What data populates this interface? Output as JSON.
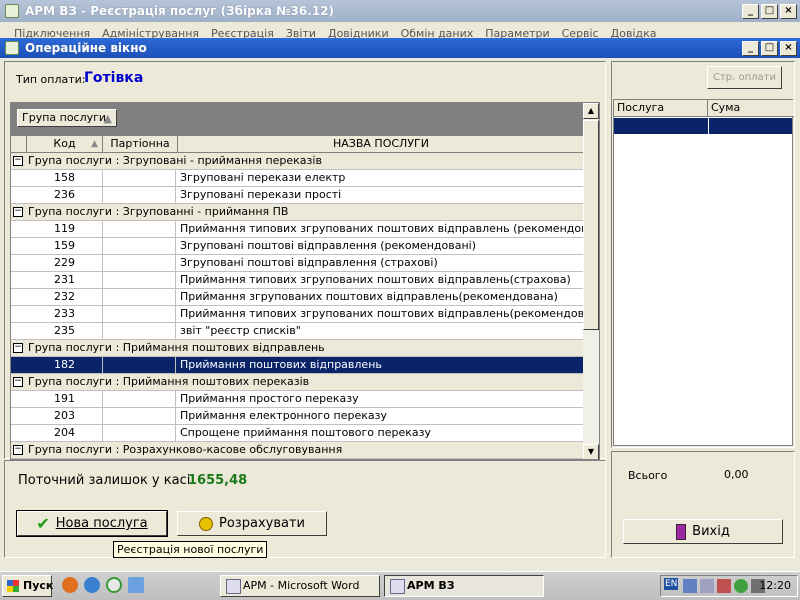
{
  "app": {
    "title": "АРМ ВЗ - Реєстрація послуг (Збірка №36.12)",
    "menu": [
      "Підключення",
      "Адміністрування",
      "Реєстрація",
      "Звіти",
      "Довідники",
      "Обмін даних",
      "Параметри",
      "Сервіс",
      "Довідка"
    ]
  },
  "window": {
    "title": "Операційне вікно"
  },
  "payment": {
    "label": "Тип оплати:",
    "value": "Готівка"
  },
  "grouping": {
    "button_label": "Група послуги"
  },
  "columns": {
    "code": "Код",
    "partial": "Партіонна",
    "name": "НАЗВА ПОСЛУГИ"
  },
  "rows": [
    {
      "type": "group",
      "text": "Група послуги : Згруповані - приймання переказів"
    },
    {
      "type": "item",
      "code": "158",
      "partial": "",
      "name": "Згруповані перекази електр"
    },
    {
      "type": "item",
      "code": "236",
      "partial": "",
      "name": "Згруповані перекази прості"
    },
    {
      "type": "group",
      "text": "Група послуги : Згрупованні - приймання ПВ"
    },
    {
      "type": "item",
      "code": "119",
      "partial": "",
      "name": "Приймання типових згрупованих поштових відправлень (рекомендована пошта)"
    },
    {
      "type": "item",
      "code": "159",
      "partial": "",
      "name": "Згруповані поштові відправлення (рекомендовані)"
    },
    {
      "type": "item",
      "code": "229",
      "partial": "",
      "name": "Згруповані поштові відправлення (страхові)"
    },
    {
      "type": "item",
      "code": "231",
      "partial": "",
      "name": "Приймання типових згрупованих поштових відправлень(страхова)"
    },
    {
      "type": "item",
      "code": "232",
      "partial": "",
      "name": "Приймання згрупованих поштових відправлень(рекомендована)"
    },
    {
      "type": "item",
      "code": "233",
      "partial": "",
      "name": "Приймання типових згрупованих поштових відправлень(рекомендована)"
    },
    {
      "type": "item",
      "code": "235",
      "partial": "",
      "name": "звіт \"реєстр списків\""
    },
    {
      "type": "group",
      "text": "Група послуги : Приймання поштових відправлень"
    },
    {
      "type": "item",
      "code": "182",
      "partial": "",
      "name": "Приймання поштових відправлень",
      "selected": true
    },
    {
      "type": "group",
      "text": "Група послуги : Приймання поштових переказів"
    },
    {
      "type": "item",
      "code": "191",
      "partial": "",
      "name": "Приймання простого переказу"
    },
    {
      "type": "item",
      "code": "203",
      "partial": "",
      "name": "Приймання електронного переказу"
    },
    {
      "type": "item",
      "code": "204",
      "partial": "",
      "name": "Спрощене приймання поштового переказу"
    },
    {
      "type": "group",
      "text": "Група послуги : Розрахунково-касове обслуговування"
    }
  ],
  "balance": {
    "label": "Поточний залишок у касі",
    "value": "1655,48"
  },
  "buttons": {
    "new_service": "Нова послуга",
    "calculate": "Розрахувати",
    "exit": "Вихід",
    "payment_structure": "Стр. оплати"
  },
  "tooltip": "Реєстрація нової послуги",
  "right": {
    "col_service": "Послуга",
    "col_sum": "Сума",
    "total_label": "Всього",
    "total_value": "0,00"
  },
  "taskbar": {
    "start": "Пуск",
    "tasks": [
      {
        "label": "АРМ - Microsoft Word"
      },
      {
        "label": "АРМ ВЗ"
      }
    ],
    "clock": "12:20",
    "lang": "EN"
  }
}
